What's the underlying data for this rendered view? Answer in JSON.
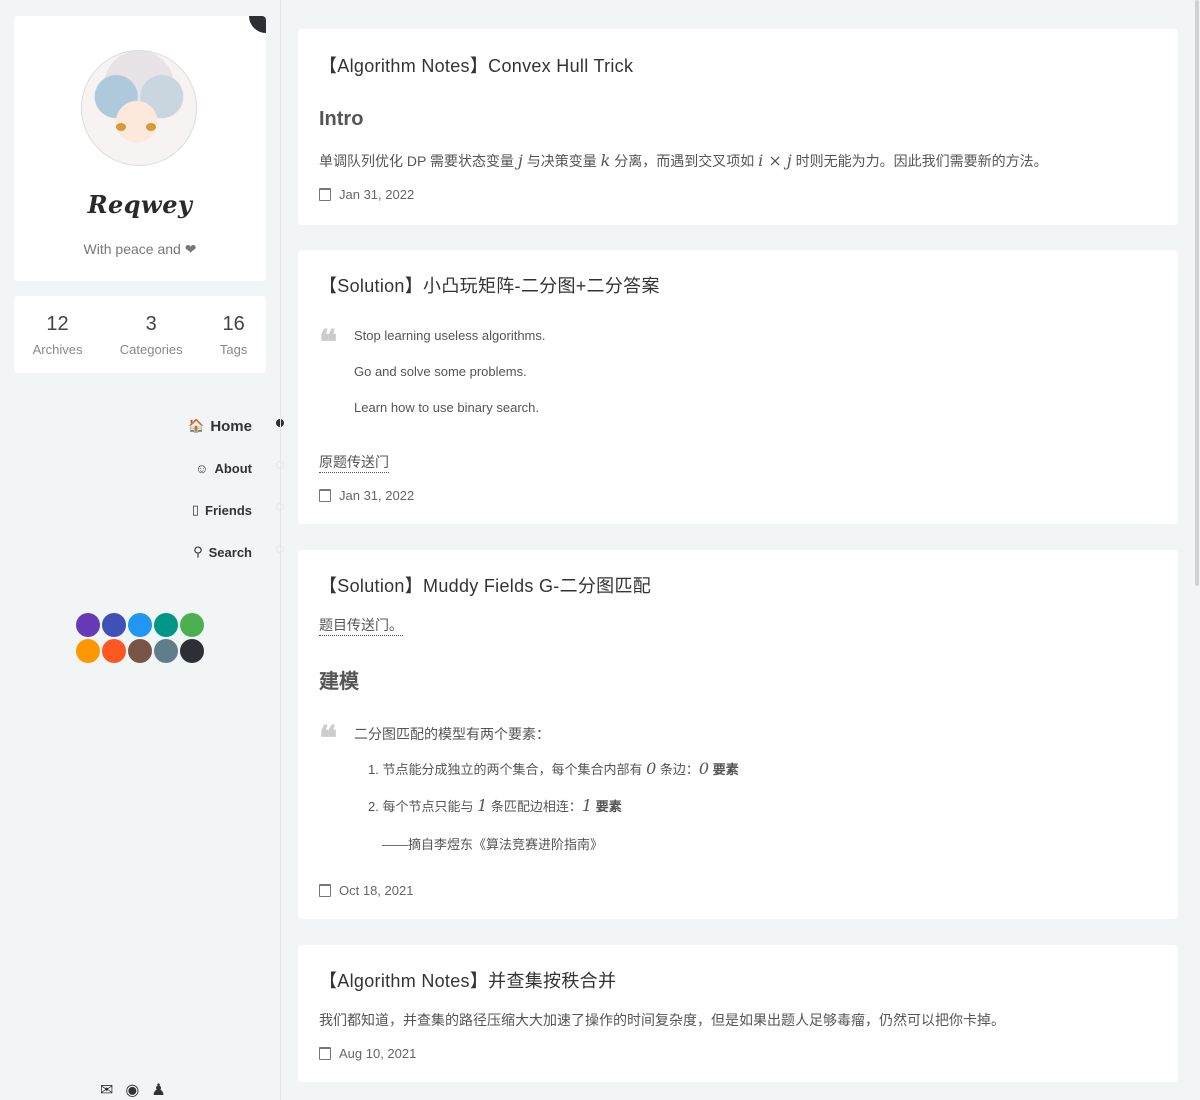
{
  "sidebar": {
    "author_name": "Reqwey",
    "author_desc": "With peace and ❤",
    "stats": [
      {
        "num": "12",
        "label": "Archives"
      },
      {
        "num": "3",
        "label": "Categories"
      },
      {
        "num": "16",
        "label": "Tags"
      }
    ],
    "nav": [
      {
        "label": "Home",
        "icon": "home-icon",
        "glyph": "🏠",
        "active": true
      },
      {
        "label": "About",
        "icon": "smile-icon",
        "glyph": "☺",
        "active": false
      },
      {
        "label": "Friends",
        "icon": "friends-icon",
        "glyph": "▯",
        "active": false
      },
      {
        "label": "Search",
        "icon": "search-icon",
        "glyph": "⚲",
        "active": false
      }
    ],
    "theme_colors": [
      "#673ab7",
      "#3f51b5",
      "#2196f3",
      "#009688",
      "#4caf50",
      "#ff9800",
      "#ff5722",
      "#795548",
      "#607d8b",
      "#2c2f33"
    ],
    "social": [
      {
        "icon": "mail-icon",
        "glyph": "✉"
      },
      {
        "icon": "github-icon",
        "glyph": "◉"
      },
      {
        "icon": "qq-icon",
        "glyph": "♟"
      }
    ]
  },
  "posts": [
    {
      "title": "【Algorithm Notes】Convex Hull Trick",
      "heading": "Intro",
      "text_a": "单调队列优化 DP 需要状态变量 ",
      "math_j": "j",
      "text_b": " 与决策变量 ",
      "math_k": "k",
      "text_c": " 分离，而遇到交叉项如 ",
      "math_ixj": "i × j",
      "text_d": " 时则无能为力。因此我们需要新的方法。",
      "date": "Jan 31, 2022"
    },
    {
      "title": "【Solution】小凸玩矩阵-二分图+二分答案",
      "quote": [
        "Stop learning useless algorithms.",
        "Go and solve some problems.",
        "Learn how to use binary search."
      ],
      "link": "原题传送门",
      "date": "Jan 31, 2022"
    },
    {
      "title": "【Solution】Muddy Fields G-二分图匹配",
      "link": "题目传送门。",
      "heading": "建模",
      "quote_intro": "二分图匹配的模型有两个要素：",
      "item1_a": "1. 节点能分成独立的两个集合，每个集合内部有 ",
      "item1_m": "0",
      "item1_b": " 条边：",
      "item1_m2": "0",
      "item1_c": " 要素",
      "item2_a": "2. 每个节点只能与 ",
      "item2_m": "1",
      "item2_b": " 条匹配边相连：",
      "item2_m2": "1",
      "item2_c": " 要素",
      "source": "——摘自李煜东《算法竞赛进阶指南》",
      "date": "Oct 18, 2021"
    },
    {
      "title": "【Algorithm Notes】并查集按秩合并",
      "text": "我们都知道，并查集的路径压缩大大加速了操作的时间复杂度，但是如果出题人足够毒瘤，仍然可以把你卡掉。",
      "date": "Aug 10, 2021"
    }
  ]
}
